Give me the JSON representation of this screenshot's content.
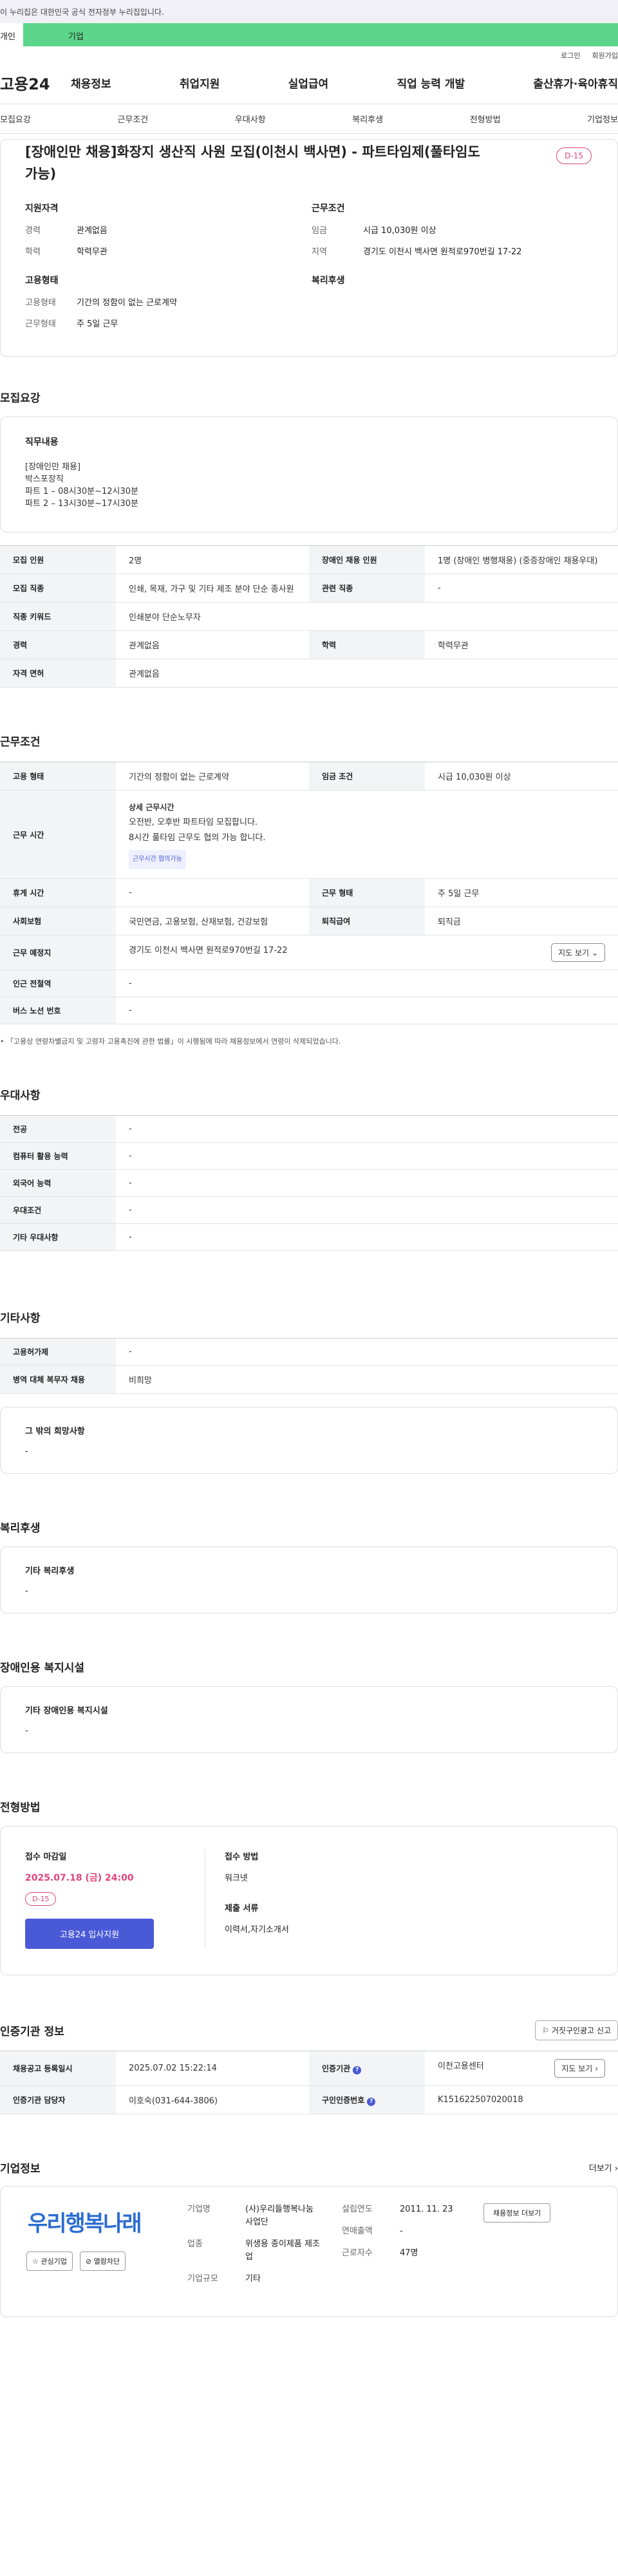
{
  "gov_banner": "이 누리집은 대한민국 공식 전자정부 누리집입니다.",
  "audience_tabs": [
    "개인",
    "기업"
  ],
  "util": [
    "로그인",
    "회원가입"
  ],
  "logo": "고용24",
  "gnb": [
    "채용정보",
    "취업지원",
    "실업급여",
    "직업 능력 개발",
    "출산휴가·육아휴직"
  ],
  "snb": [
    "모집요강",
    "근무조건",
    "우대사항",
    "복리후생",
    "전형방법",
    "기업정보"
  ],
  "job": {
    "title": "[장애인만 채용]화장지 생산직 사원 모집(이천시 백사면) - 파트타임제(풀타임도 가능)",
    "dday": "D-15",
    "req_head": "지원자격",
    "career_k": "경력",
    "career_v": "관계없음",
    "edu_k": "학력",
    "edu_v": "학력무관",
    "emp_head": "고용형태",
    "emptype_k": "고용형태",
    "emptype_v": "기간의 정함이 없는 근로계약",
    "worktype_k": "근무형태",
    "worktype_v": "주 5일 근무",
    "cond_head": "근무조건",
    "wage_k": "임금",
    "wage_v": "시급 10,030원 이상",
    "region_k": "지역",
    "region_v": "경기도 이천시 백사면 원적로970번길 17-22",
    "welfare_head": "복리후생"
  },
  "recruit": {
    "section": "모집요강",
    "duty_head": "직무내용",
    "duty_body": "[장애인만 채용]\n 박스포장직\n파트 1 –  08시30분~12시30분\n파트 2 –  13시30분~17시30분",
    "rows": [
      {
        "k1": "모집 인원",
        "v1": "2명",
        "k2": "장애인 채용 인원",
        "v2": "1명 (장애인 병행채용) (중증장애인 채용우대)"
      },
      {
        "k1": "모집 직종",
        "v1": "인쇄, 목재, 가구 및 기타 제조 분야 단순 종사원",
        "k2": "관련 직종",
        "v2": "-"
      },
      {
        "k1": "직종 키워드",
        "v1": "인쇄분야 단순노무자"
      },
      {
        "k1": "경력",
        "v1": "관계없음",
        "k2": "학력",
        "v2": "학력무관"
      },
      {
        "k1": "자격 면허",
        "v1": "관계없음"
      }
    ]
  },
  "work": {
    "section": "근무조건",
    "emptype_k": "고용 형태",
    "emptype_v": "기간의 정함이 없는 근로계약",
    "wage_k": "임금 조건",
    "wage_v": "시급 10,030원 이상",
    "time_k": "근무 시간",
    "time_head": "상세 근무시간",
    "time_l1": "오전반, 오후반 파트타임 모집합니다.",
    "time_l2": "8시간 풀타임 근무도 협의 가능 합니다.",
    "time_chip": "근무시간 협의가능",
    "rest_k": "휴게 시간",
    "rest_v": "-",
    "form_k": "근무 형태",
    "form_v": "주 5일 근무",
    "ins_k": "사회보험",
    "ins_v": "국민연금, 고용보험, 산재보험, 건강보험",
    "ret_k": "퇴직급여",
    "ret_v": "퇴직금",
    "place_k": "근무 예정지",
    "place_v": "경기도 이천시 백사면 원적로970번길 17-22",
    "map_btn": "지도 보기",
    "station_k": "인근 전철역",
    "station_v": "-",
    "bus_k": "버스 노선 번호",
    "bus_v": "-",
    "note": "「고용상 연령차별금지 및 고령자 고용촉진에 관한 법률」이 시행됨에 따라 채용정보에서 연령이 삭제되었습니다."
  },
  "pref": {
    "section": "우대사항",
    "rows": [
      {
        "k": "전공",
        "v": "-"
      },
      {
        "k": "컴퓨터 활용 능력",
        "v": "-"
      },
      {
        "k": "외국어 능력",
        "v": "-"
      },
      {
        "k": "우대조건",
        "v": "-"
      },
      {
        "k": "기타 우대사항",
        "v": "-"
      }
    ]
  },
  "etc": {
    "section": "기타사항",
    "rows": [
      {
        "k": "고용허가제",
        "v": "-"
      },
      {
        "k": "병역 대체 복무자 채용",
        "v": "비희망"
      }
    ],
    "other_head": "그 밖의 희망사항",
    "other_v": "-"
  },
  "welfare": {
    "section": "복리후생",
    "head": "기타 복리후생",
    "v": "-"
  },
  "disab": {
    "section": "장애인용 복지시설",
    "head": "기타 장애인용 복지시설",
    "v": "-"
  },
  "apply": {
    "section": "전형방법",
    "deadline_head": "접수 마감일",
    "deadline": "2025.07.18 (금) 24:00",
    "dday": "D-15",
    "apply_btn": "고용24 입사지원",
    "method_head": "접수 방법",
    "method_v": "워크넷",
    "docs_head": "제출 서류",
    "docs_v": "이력서,자기소개서"
  },
  "agency": {
    "section": "인증기관 정보",
    "report_btn": "거짓구인광고 신고",
    "reg_k": "채용공고 등록일시",
    "reg_v": "2025.07.02 15:22:14",
    "org_k": "인증기관",
    "org_v": "이천고용센터",
    "map_btn": "지도 보기",
    "mgr_k": "인증기관 담당자",
    "mgr_v": "이호숙(031-644-3806)",
    "no_k": "구인인증번호",
    "no_v": "K151622507020018"
  },
  "company": {
    "section": "기업정보",
    "more": "더보기",
    "logo_text": "우리행복나래",
    "fav_btn": "관심기업",
    "block_btn": "열람차단",
    "name_k": "기업명",
    "name_v": "(사)우리들행복나눔 사업단",
    "year_k": "설립연도",
    "year_v": "2011. 11. 23",
    "jobs_btn": "채용정보 더보기",
    "sector_k": "업종",
    "sector_v": "위생용 종이제품 제조업",
    "sales_k": "연매출액",
    "sales_v": "-",
    "size_k": "기업규모",
    "size_v": "기타",
    "staff_k": "근로자수",
    "staff_v": "47명"
  }
}
